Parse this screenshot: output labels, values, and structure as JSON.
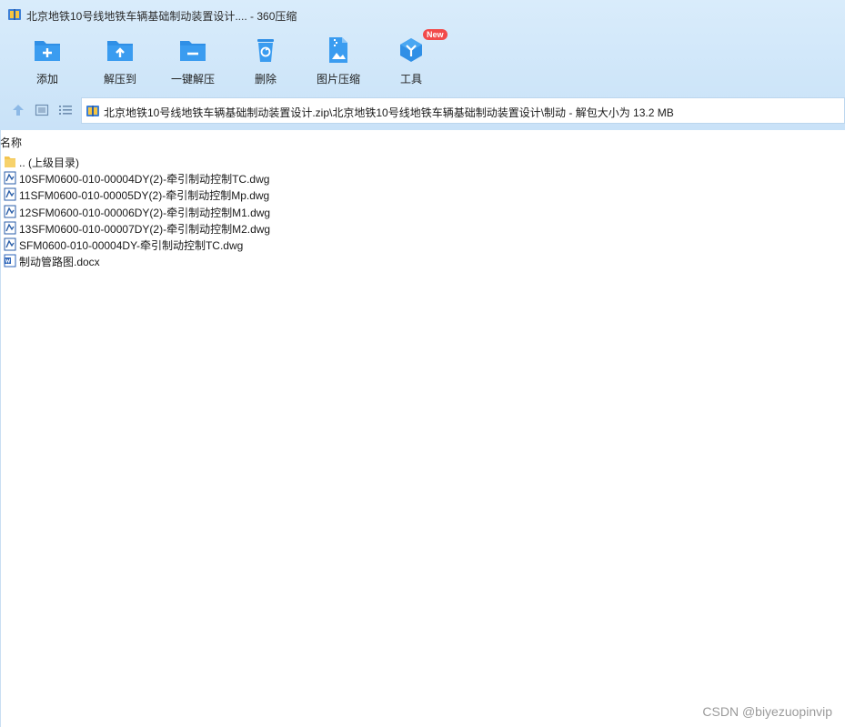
{
  "window": {
    "title": "北京地铁10号线地铁车辆基础制动装置设计.... - 360压缩"
  },
  "toolbar": {
    "items": [
      {
        "label": "添加",
        "icon": "folder-add-icon"
      },
      {
        "label": "解压到",
        "icon": "folder-extract-icon"
      },
      {
        "label": "一键解压",
        "icon": "folder-oneclick-extract-icon"
      },
      {
        "label": "删除",
        "icon": "recycle-bin-icon"
      },
      {
        "label": "图片压缩",
        "icon": "image-compress-icon"
      },
      {
        "label": "工具",
        "icon": "tools-icon",
        "badge": "New"
      }
    ]
  },
  "nav": {
    "address": "北京地铁10号线地铁车辆基础制动装置设计.zip\\北京地铁10号线地铁车辆基础制动装置设计\\制动 - 解包大小为 13.2 MB"
  },
  "list": {
    "column_name": "名称",
    "items": [
      {
        "name": ".. (上级目录)",
        "type": "folder"
      },
      {
        "name": "10SFM0600-010-00004DY(2)-牵引制动控制TC.dwg",
        "type": "dwg"
      },
      {
        "name": "11SFM0600-010-00005DY(2)-牵引制动控制Mp.dwg",
        "type": "dwg"
      },
      {
        "name": "12SFM0600-010-00006DY(2)-牵引制动控制M1.dwg",
        "type": "dwg"
      },
      {
        "name": "13SFM0600-010-00007DY(2)-牵引制动控制M2.dwg",
        "type": "dwg"
      },
      {
        "name": "SFM0600-010-00004DY-牵引制动控制TC.dwg",
        "type": "dwg"
      },
      {
        "name": "制动管路图.docx",
        "type": "docx"
      }
    ]
  },
  "watermark": "CSDN @biyezuopinvip",
  "colors": {
    "accent": "#2f8fe6",
    "toolbar_bg": "#d4e8fa",
    "badge": "#f24a4a"
  }
}
